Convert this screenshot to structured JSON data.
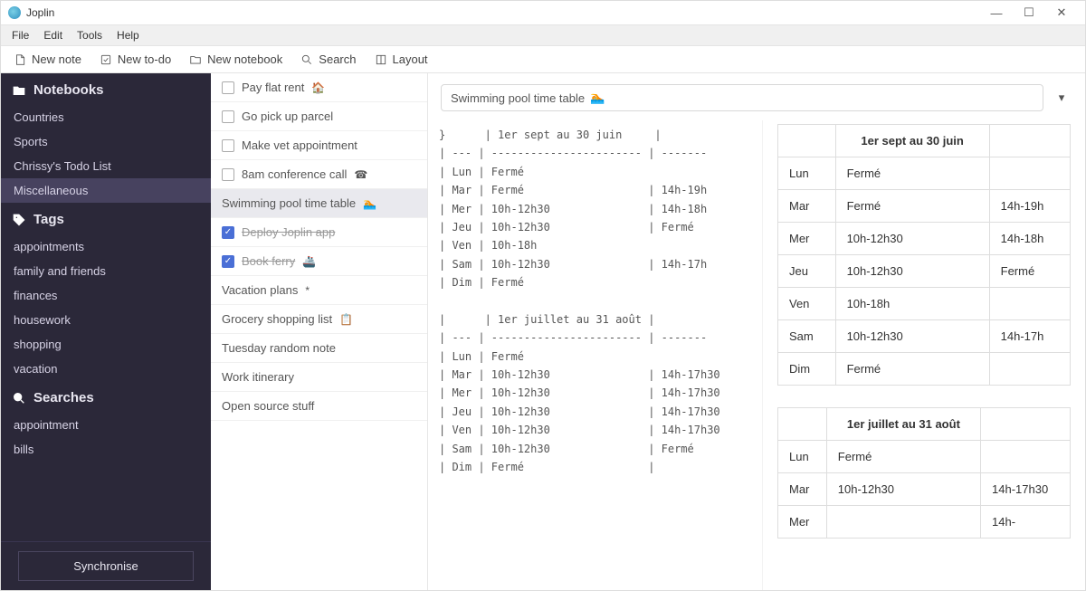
{
  "app": {
    "title": "Joplin"
  },
  "menus": [
    {
      "label": "File"
    },
    {
      "label": "Edit"
    },
    {
      "label": "Tools"
    },
    {
      "label": "Help"
    }
  ],
  "toolbar": {
    "new_note": "New note",
    "new_todo": "New to-do",
    "new_notebook": "New notebook",
    "search": "Search",
    "layout": "Layout"
  },
  "sidebar": {
    "notebooks_label": "Notebooks",
    "notebooks": [
      {
        "label": "Countries"
      },
      {
        "label": "Sports"
      },
      {
        "label": "Chrissy's Todo List"
      },
      {
        "label": "Miscellaneous",
        "selected": true
      }
    ],
    "tags_label": "Tags",
    "tags": [
      {
        "label": "appointments"
      },
      {
        "label": "family and friends"
      },
      {
        "label": "finances"
      },
      {
        "label": "housework"
      },
      {
        "label": "shopping"
      },
      {
        "label": "vacation"
      }
    ],
    "searches_label": "Searches",
    "searches": [
      {
        "label": "appointment"
      },
      {
        "label": "bills"
      }
    ],
    "sync_label": "Synchronise"
  },
  "notes": [
    {
      "label": "Pay flat rent",
      "todo": true,
      "checked": false,
      "emoji": "🏠"
    },
    {
      "label": "Go pick up parcel",
      "todo": true,
      "checked": false
    },
    {
      "label": "Make vet appointment",
      "todo": true,
      "checked": false
    },
    {
      "label": "8am conference call",
      "todo": true,
      "checked": false,
      "emoji": "☎"
    },
    {
      "label": "Swimming pool time table",
      "selected": true,
      "emoji": "🏊"
    },
    {
      "label": "Deploy Joplin app",
      "todo": true,
      "checked": true
    },
    {
      "label": "Book ferry",
      "todo": true,
      "checked": true,
      "emoji": "🚢"
    },
    {
      "label": "Vacation plans",
      "emoji": "*"
    },
    {
      "label": "Grocery shopping list",
      "emoji": "📋"
    },
    {
      "label": "Tuesday random note"
    },
    {
      "label": "Work itinerary"
    },
    {
      "label": "Open source stuff"
    }
  ],
  "note_title": {
    "text": "Swimming pool time table",
    "emoji": "🏊"
  },
  "markdown_source": "}      | 1er sept au 30 juin     |\n| --- | ----------------------- | -------\n| Lun | Fermé\n| Mar | Fermé                   | 14h-19h\n| Mer | 10h-12h30               | 14h-18h\n| Jeu | 10h-12h30               | Fermé\n| Ven | 10h-18h\n| Sam | 10h-12h30               | 14h-17h\n| Dim | Fermé\n\n|      | 1er juillet au 31 août |\n| --- | ----------------------- | -------\n| Lun | Fermé\n| Mar | 10h-12h30               | 14h-17h30\n| Mer | 10h-12h30               | 14h-17h30\n| Jeu | 10h-12h30               | 14h-17h30\n| Ven | 10h-12h30               | 14h-17h30\n| Sam | 10h-12h30               | Fermé\n| Dim | Fermé                   |",
  "tables": [
    {
      "title": "1er sept au 30 juin",
      "rows": [
        {
          "day": "Lun",
          "c1": "Fermé",
          "c2": ""
        },
        {
          "day": "Mar",
          "c1": "Fermé",
          "c2": "14h-19h"
        },
        {
          "day": "Mer",
          "c1": "10h-12h30",
          "c2": "14h-18h"
        },
        {
          "day": "Jeu",
          "c1": "10h-12h30",
          "c2": "Fermé"
        },
        {
          "day": "Ven",
          "c1": "10h-18h",
          "c2": ""
        },
        {
          "day": "Sam",
          "c1": "10h-12h30",
          "c2": "14h-17h"
        },
        {
          "day": "Dim",
          "c1": "Fermé",
          "c2": ""
        }
      ]
    },
    {
      "title": "1er juillet au 31 août",
      "rows": [
        {
          "day": "Lun",
          "c1": "Fermé",
          "c2": ""
        },
        {
          "day": "Mar",
          "c1": "10h-12h30",
          "c2": "14h-17h30"
        },
        {
          "day": "Mer",
          "c1": "",
          "c2": "14h-"
        }
      ]
    }
  ]
}
